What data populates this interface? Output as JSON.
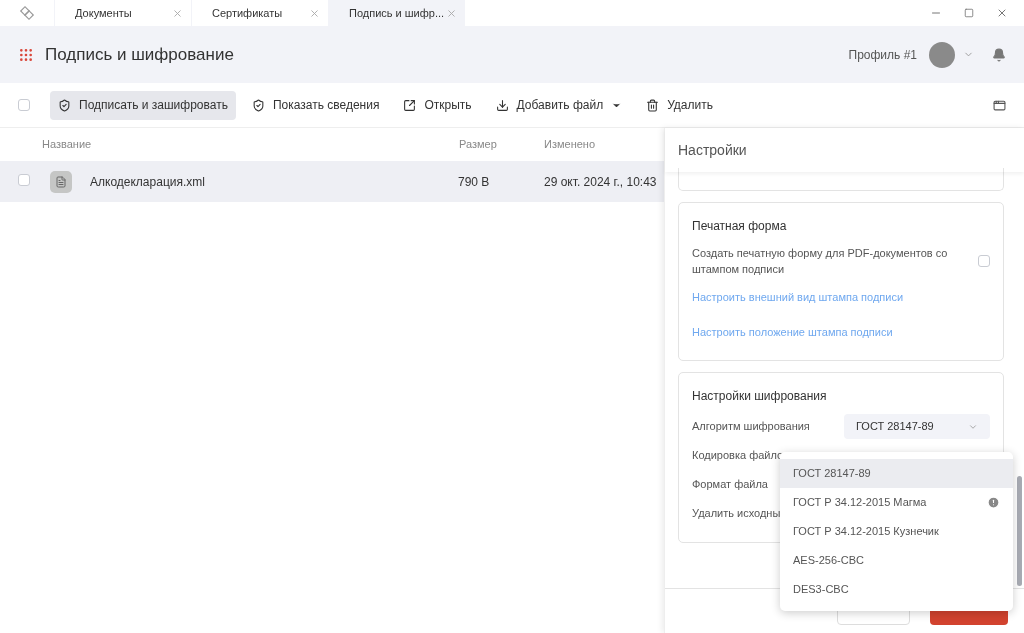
{
  "titlebar": {
    "tabs": [
      {
        "label": "Документы",
        "selected": false
      },
      {
        "label": "Сертификаты",
        "selected": false
      },
      {
        "label": "Подпись и шифр...",
        "selected": true
      }
    ]
  },
  "header": {
    "title": "Подпись и шифрование",
    "profile": "Профиль #1"
  },
  "toolbar": {
    "select_all_checked": false,
    "buttons": [
      {
        "label": "Подписать и зашифровать",
        "selected": true,
        "caret": false
      },
      {
        "label": "Показать сведения",
        "selected": false,
        "caret": false
      },
      {
        "label": "Открыть",
        "selected": false,
        "caret": false
      },
      {
        "label": "Добавить файл",
        "selected": false,
        "caret": true
      },
      {
        "label": "Удалить",
        "selected": false,
        "caret": false
      }
    ]
  },
  "file_list": {
    "columns": [
      "Название",
      "Размер",
      "Изменено"
    ],
    "rows": [
      {
        "name": "Алкодекларация.xml",
        "size": "790 B",
        "modified": "29 окт. 2024 г., 10:43",
        "checked": false,
        "selected": true
      }
    ]
  },
  "settings": {
    "title": "Настройки",
    "print_form": {
      "title": "Печатная форма",
      "option": "Создать печатную форму для PDF-документов со штампом подписи",
      "checked": false,
      "links": [
        "Настроить внешний вид штампа подписи",
        "Настроить положение штампа подписи"
      ]
    },
    "encryption": {
      "title": "Настройки шифрования",
      "fields": [
        {
          "label": "Алгоритм шифрования",
          "value": "ГОСТ 28147-89"
        },
        {
          "label": "Кодировка файло"
        },
        {
          "label": "Формат файла"
        },
        {
          "label": "Удалить исходны"
        }
      ],
      "menu": [
        {
          "label": "ГОСТ 28147-89",
          "selected": true,
          "warning": false
        },
        {
          "label": "ГОСТ Р 34.12-2015 Магма",
          "selected": false,
          "warning": true
        },
        {
          "label": "ГОСТ Р 34.12-2015 Кузнечик",
          "selected": false,
          "warning": false
        },
        {
          "label": "AES-256-CBC",
          "selected": false,
          "warning": false
        },
        {
          "label": "DES3-CBC",
          "selected": false,
          "warning": false
        }
      ]
    }
  }
}
